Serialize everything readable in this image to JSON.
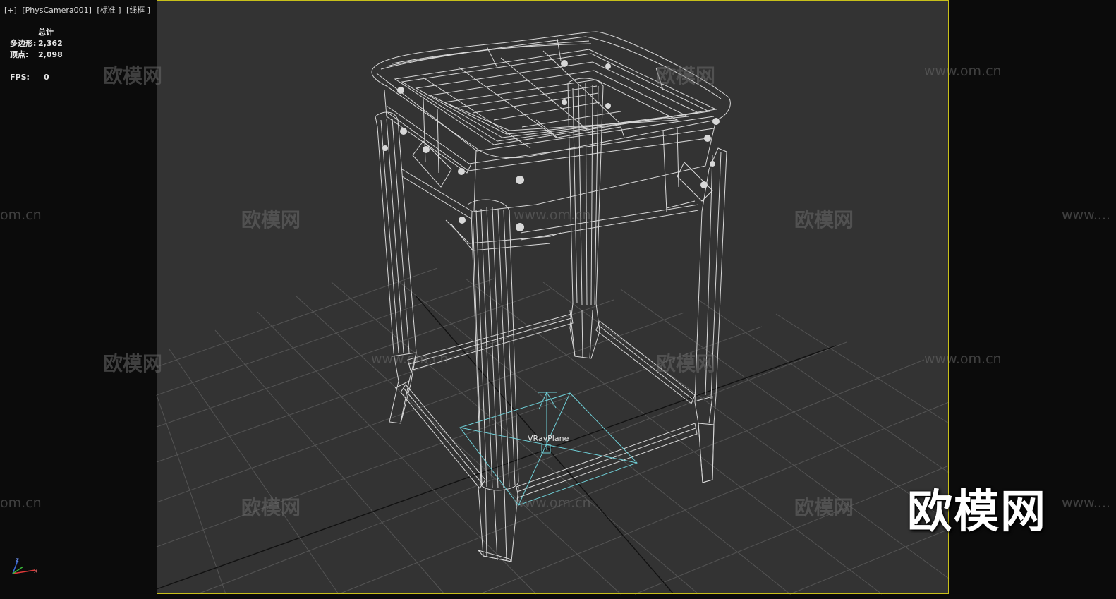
{
  "viewport_label": {
    "plus": "[+]",
    "camera": "[PhysCamera001]",
    "shading": "[标准 ]",
    "mode": "[线框 ]"
  },
  "stats": {
    "header": "总计",
    "polys_label": "多边形:",
    "polys_value": "2,362",
    "verts_label": "顶点:",
    "verts_value": "2,098",
    "fps_label": "FPS:",
    "fps_value": "0"
  },
  "object_label": "VRayPlane",
  "axis": {
    "z": "z",
    "x": "x"
  },
  "watermark": {
    "cn": "欧模网",
    "en": "www.om.cn",
    "en_short": "om.cn",
    "en_partial": "www...."
  },
  "brand": "欧模网",
  "colors": {
    "viewport_bg": "#333333",
    "outer_bg": "#0b0b0b",
    "grid": "#505050",
    "wire": "#e6e6e6",
    "frame": "#c8c01a",
    "vrayplane": "#6fd0d8"
  }
}
